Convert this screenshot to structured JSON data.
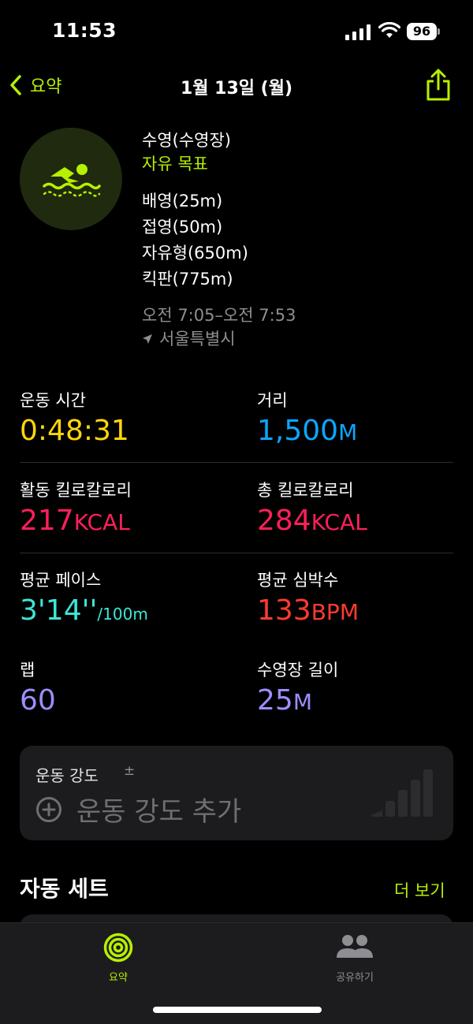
{
  "status": {
    "time": "11:53",
    "battery": "96"
  },
  "nav": {
    "back_label": "요약",
    "title": "1월 13일 (월)"
  },
  "workout": {
    "type": "수영(수영장)",
    "goal": "자유 목표",
    "strokes": [
      "배영(25m)",
      "접영(50m)",
      "자유형(650m)",
      "킥판(775m)"
    ],
    "time_range": "오전 7:05–오전 7:53",
    "location": "서울특별시"
  },
  "stats": {
    "duration": {
      "label": "운동 시간",
      "value": "0:48:31",
      "color": "#ffd60a"
    },
    "distance": {
      "label": "거리",
      "value": "1,500",
      "unit": "M",
      "color": "#0aa7ff"
    },
    "active_kcal": {
      "label": "활동 킬로칼로리",
      "value": "217",
      "unit": "KCAL",
      "color": "#ff1f5a"
    },
    "total_kcal": {
      "label": "총 킬로칼로리",
      "value": "284",
      "unit": "KCAL",
      "color": "#ff1f5a"
    },
    "avg_pace": {
      "label": "평균 페이스",
      "value": "3'14''",
      "unit": "/100m",
      "color": "#3ee6d6"
    },
    "avg_hr": {
      "label": "평균 심박수",
      "value": "133",
      "unit": "BPM",
      "color": "#ff3b30"
    },
    "laps": {
      "label": "랩",
      "value": "60",
      "color": "#9f8cff"
    },
    "pool_length": {
      "label": "수영장 길이",
      "value": "25",
      "unit": "M",
      "color": "#9f8cff"
    }
  },
  "intensity": {
    "title": "운동 강도",
    "pm_symbol": "±",
    "add_label": "운동 강도 추가"
  },
  "auto_sets": {
    "title": "자동 세트",
    "more_label": "더 보기"
  },
  "tabs": [
    {
      "label": "요약",
      "icon": "activity-rings-icon"
    },
    {
      "label": "공유하기",
      "icon": "people-icon"
    }
  ],
  "colors": {
    "accent": "#b7f000",
    "background": "#000000",
    "card": "#1c1c1e"
  }
}
